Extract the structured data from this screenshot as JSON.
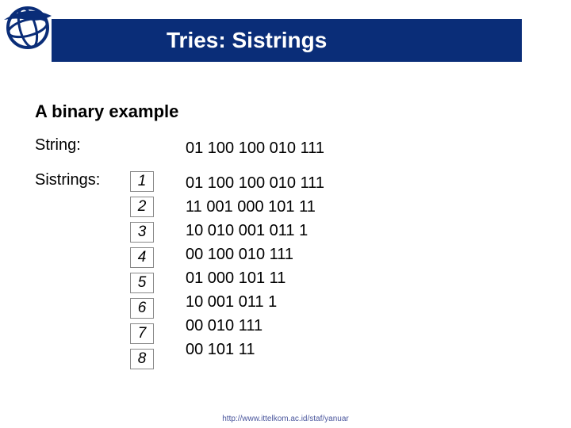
{
  "title": "Tries: Sistrings",
  "subtitle": "A binary example",
  "string_label": "String:",
  "string_value": "01 100 100 010 111",
  "sistrings_label": "Sistrings:",
  "sistrings": [
    {
      "n": "1",
      "v": "01 100 100 010 111"
    },
    {
      "n": "2",
      "v": "11 001 000 101 11"
    },
    {
      "n": "3",
      "v": "10 010 001 011 1"
    },
    {
      "n": "4",
      "v": "00 100 010 111"
    },
    {
      "n": "5",
      "v": "01 000 101 11"
    },
    {
      "n": "6",
      "v": "10 001 011 1"
    },
    {
      "n": "7",
      "v": "00 010 111"
    },
    {
      "n": "8",
      "v": "00 101 11"
    }
  ],
  "footer": "http://www.ittelkom.ac.id/staf/yanuar"
}
